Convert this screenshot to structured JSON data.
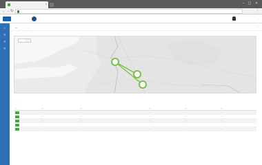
{
  "browser": {
    "tab_title": "...",
    "url": "...",
    "window_controls": "–  ▢  ✕"
  },
  "header": {
    "logo_text": "...",
    "org_line1": "...",
    "org_line2": "...",
    "user_label": "..."
  },
  "page": {
    "title": "...",
    "subtitle": "...",
    "actions": "..."
  },
  "map": {
    "section_label": "...",
    "toggle": [
      "...",
      "..."
    ],
    "cities": [
      "...",
      "...",
      "..."
    ],
    "attribution": "...",
    "route_color": "#7cc242",
    "pin_color": "#7cc242"
  },
  "table": {
    "section_label": "...",
    "columns": [
      "...",
      "...",
      "...",
      "...",
      "...",
      "..."
    ],
    "rows": [
      [
        "...",
        "...",
        "...",
        "...",
        "...",
        "..."
      ],
      [
        "...",
        "...",
        "...",
        "...",
        "...",
        "..."
      ],
      [
        "...",
        "...",
        "...",
        "...",
        "...",
        "..."
      ],
      [
        "...",
        "...",
        "...",
        "...",
        "...",
        "..."
      ],
      [
        "...",
        "...",
        "...",
        "...",
        "...",
        "..."
      ]
    ]
  },
  "colors": {
    "accent": "#2f6fb6",
    "status_green": "#3ea53e"
  },
  "icons": [
    "lock-icon",
    "shield-logo-icon",
    "user-icon",
    "home-icon",
    "menu-icon",
    "map-pin-icon"
  ]
}
